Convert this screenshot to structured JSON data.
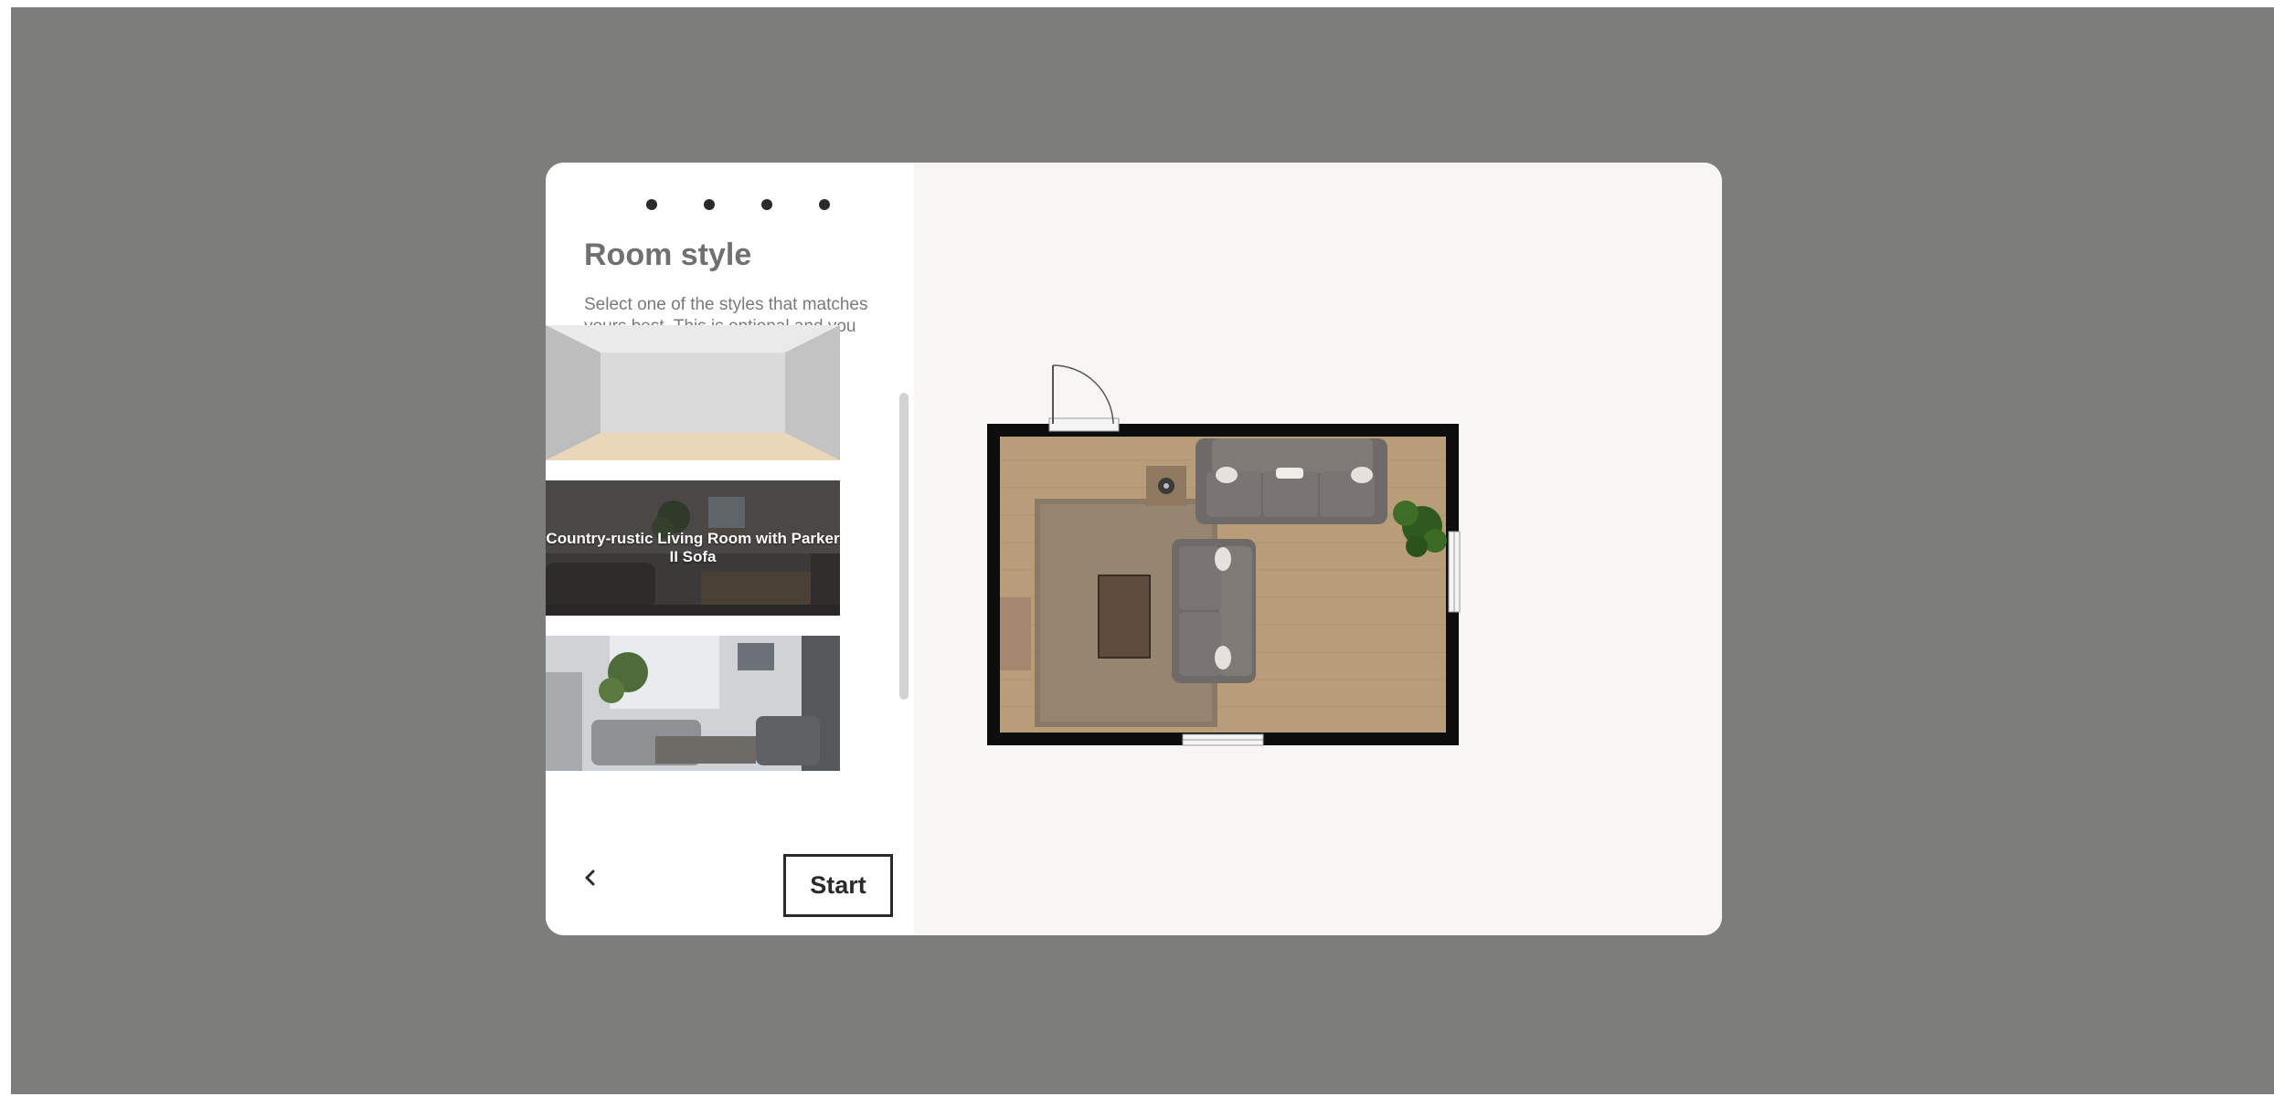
{
  "wizard": {
    "step_count": 4,
    "title": "Room style",
    "description": "Select one of the styles that matches yours best. This is optional and you can always change the roomstyle later.",
    "styles": [
      {
        "label": "",
        "thumbnail": "empty-room-image"
      },
      {
        "label": "Country-rustic Living Room with Parker II Sofa",
        "thumbnail": "country-rustic-living-room-image"
      },
      {
        "label": "",
        "thumbnail": "modern-grey-living-room-image"
      }
    ],
    "back_icon": "chevron-left-icon",
    "start_label": "Start"
  },
  "preview": {
    "icon": "floor-plan-preview"
  },
  "colors": {
    "backdrop": "#7d7d7c",
    "panel": "#ffffff",
    "preview_bg": "#f7f6f4",
    "text_primary": "#2a2a2a",
    "text_muted": "#707070"
  }
}
